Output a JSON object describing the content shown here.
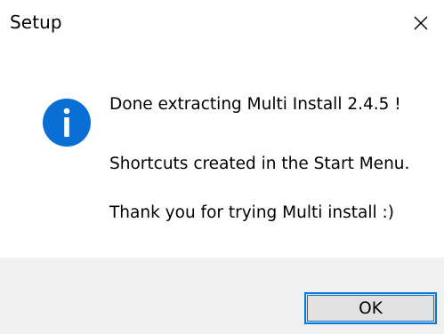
{
  "window": {
    "title": "Setup",
    "close_icon": "close-icon"
  },
  "message": {
    "icon": "info-icon",
    "icon_color": "#0a6fd4",
    "lines": [
      "Done extracting Multi Install 2.4.5 !",
      "Shortcuts created in the Start Menu.",
      "Thank you for trying Multi install :)"
    ]
  },
  "buttons": {
    "ok_label": "OK",
    "focus_color": "#0078d7"
  }
}
